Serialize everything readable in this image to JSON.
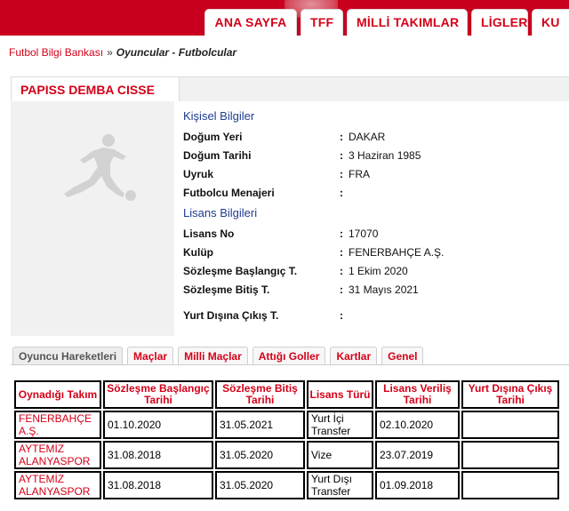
{
  "nav": {
    "tabs": [
      "ANA SAYFA",
      "TFF",
      "MİLLİ TAKIMLAR",
      "LİGLER",
      "KU"
    ]
  },
  "breadcrumb": {
    "root": "Futbol Bilgi Bankası",
    "separator": "»",
    "current": "Oyuncular - Futbolcular"
  },
  "player": {
    "name": "PAPISS DEMBA CISSE",
    "personal_title": "Kişisel Bilgiler",
    "personal": [
      {
        "label": "Doğum Yeri",
        "value": "DAKAR"
      },
      {
        "label": "Doğum Tarihi",
        "value": "3 Haziran 1985"
      },
      {
        "label": "Uyruk",
        "value": "FRA"
      },
      {
        "label": "Futbolcu Menajeri",
        "value": ""
      }
    ],
    "license_title": "Lisans Bilgileri",
    "license": [
      {
        "label": "Lisans No",
        "value": "17070"
      },
      {
        "label": "Kulüp",
        "value": "FENERBAHÇE A.Ş."
      },
      {
        "label": "Sözleşme Başlangıç T.",
        "value": "1 Ekim 2020"
      },
      {
        "label": "Sözleşme Bitiş T.",
        "value": "31 Mayıs 2021"
      }
    ],
    "abroad": {
      "label": "Yurt Dışına Çıkış T.",
      "value": ""
    }
  },
  "subtabs": [
    "Oyuncu Hareketleri",
    "Maçlar",
    "Milli Maçlar",
    "Attığı Goller",
    "Kartlar",
    "Genel"
  ],
  "table": {
    "headers": [
      "Oynadığı Takım",
      "Sözleşme Başlangıç Tarihi",
      "Sözleşme Bitiş Tarihi",
      "Lisans Türü",
      "Lisans Veriliş Tarihi",
      "Yurt Dışına Çıkış Tarihi"
    ],
    "rows": [
      [
        "FENERBAHÇE A.Ş.",
        "01.10.2020",
        "31.05.2021",
        "Yurt İçi Transfer",
        "02.10.2020",
        ""
      ],
      [
        "AYTEMİZ ALANYASPOR",
        "31.08.2018",
        "31.05.2020",
        "Vize",
        "23.07.2019",
        ""
      ],
      [
        "AYTEMİZ ALANYASPOR",
        "31.08.2018",
        "31.05.2020",
        "Yurt Dışı Transfer",
        "01.09.2018",
        ""
      ]
    ]
  },
  "colors": {
    "brand_red": "#c8001e",
    "link_red": "#d40018",
    "section_blue": "#1f3c8f"
  },
  "icons": {
    "player_photo": "footballer-silhouette-icon"
  }
}
